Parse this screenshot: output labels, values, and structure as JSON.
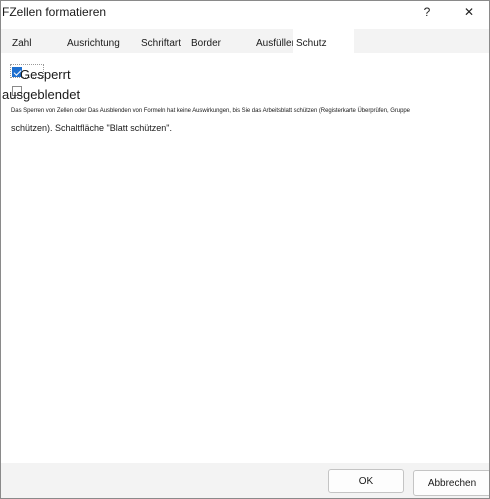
{
  "window": {
    "title": "FZellen formatieren",
    "help_glyph": "?",
    "close_glyph": "✕"
  },
  "tabs": [
    {
      "label": "Zahl"
    },
    {
      "label": "Ausrichtung"
    },
    {
      "label": "Schriftart"
    },
    {
      "label": "Border"
    },
    {
      "label": "Ausfüllen"
    },
    {
      "label": "Schutz",
      "active": true
    }
  ],
  "protection": {
    "locked_label": "Gesperrt",
    "locked_checked": true,
    "hidden_label": "ausgeblendet",
    "hidden_checked": false,
    "info_line1": "Das Sperren von Zellen oder Das Ausblenden von Formeln hat keine Auswirkungen, bis Sie das Arbeitsblatt schützen (Registerkarte Überprüfen, Gruppe",
    "info_line2": "schützen). Schaltfläche \"Blatt schützen\"."
  },
  "footer": {
    "ok_label": "OK",
    "cancel_label": "Abbrechen"
  },
  "colors": {
    "accent": "#1e6fcf",
    "tab_strip": "#f3f3f3",
    "footer": "#f3f3f3"
  }
}
